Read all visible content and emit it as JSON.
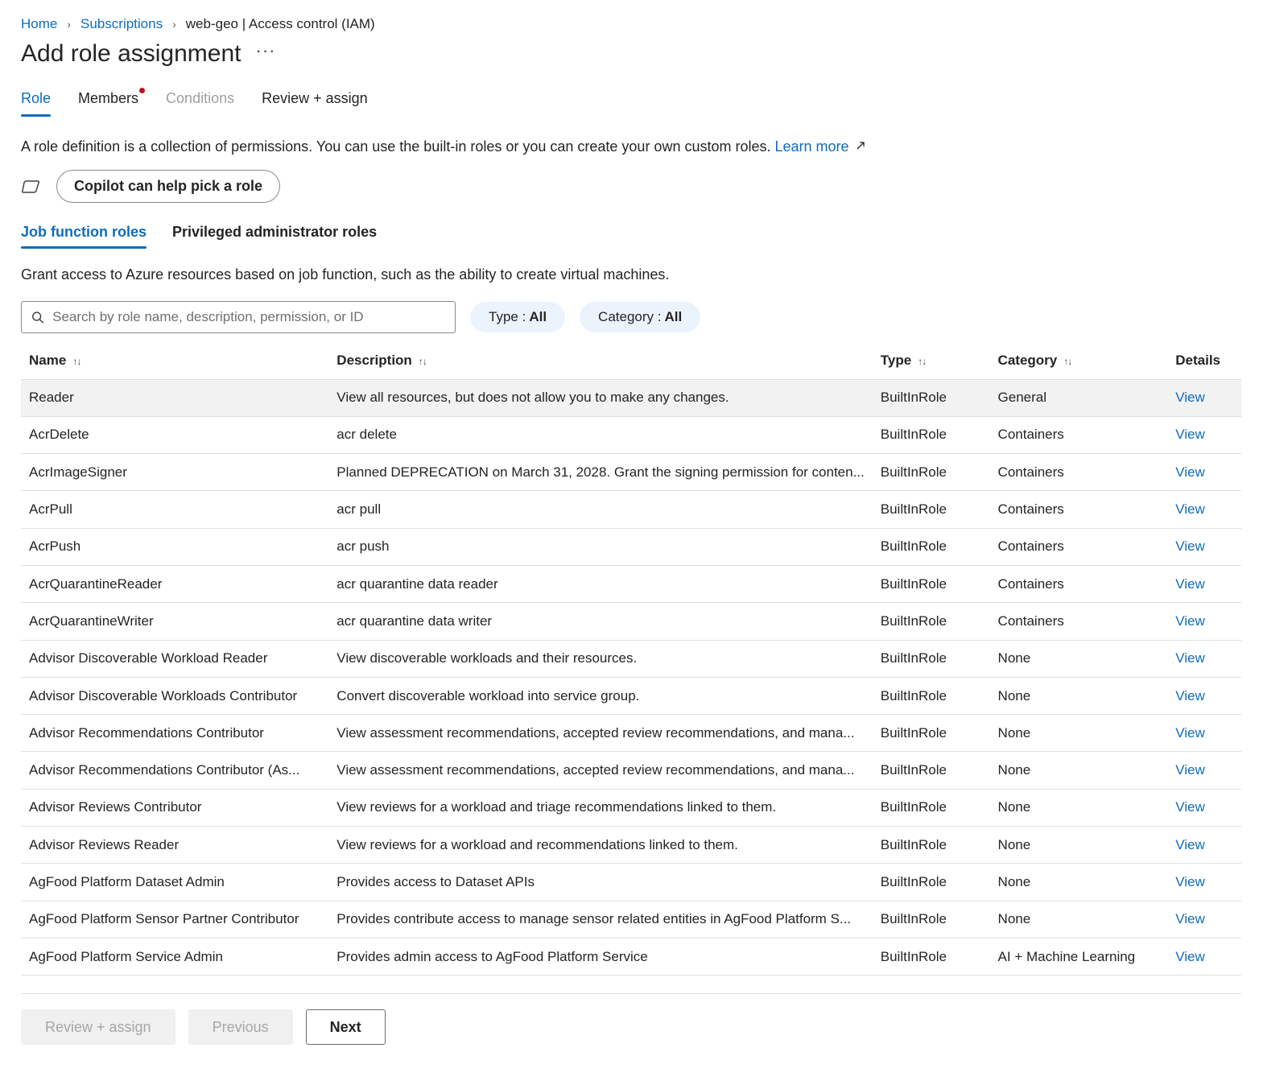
{
  "breadcrumb": {
    "items": [
      "Home",
      "Subscriptions"
    ],
    "current": "web-geo | Access control (IAM)",
    "separator": "›"
  },
  "page": {
    "title": "Add role assignment",
    "more": "···"
  },
  "wizard_tabs": [
    "Role",
    "Members",
    "Conditions",
    "Review + assign"
  ],
  "intro": {
    "text": "A role definition is a collection of permissions. You can use the built-in roles or you can create your own custom roles.",
    "link": "Learn more"
  },
  "copilot": {
    "button": "Copilot can help pick a role"
  },
  "role_tabs": [
    "Job function roles",
    "Privileged administrator roles"
  ],
  "tab_description": "Grant access to Azure resources based on job function, such as the ability to create virtual machines.",
  "search": {
    "placeholder": "Search by role name, description, permission, or ID"
  },
  "filters": {
    "type_label": "Type : ",
    "type_value": "All",
    "category_label": "Category : ",
    "category_value": "All"
  },
  "table": {
    "headers": [
      "Name",
      "Description",
      "Type",
      "Category",
      "Details"
    ],
    "rows": [
      [
        "Reader",
        "View all resources, but does not allow you to make any changes.",
        "BuiltInRole",
        "General",
        "View"
      ],
      [
        "AcrDelete",
        "acr delete",
        "BuiltInRole",
        "Containers",
        "View"
      ],
      [
        "AcrImageSigner",
        "Planned DEPRECATION on March 31, 2028. Grant the signing permission for conten...",
        "BuiltInRole",
        "Containers",
        "View"
      ],
      [
        "AcrPull",
        "acr pull",
        "BuiltInRole",
        "Containers",
        "View"
      ],
      [
        "AcrPush",
        "acr push",
        "BuiltInRole",
        "Containers",
        "View"
      ],
      [
        "AcrQuarantineReader",
        "acr quarantine data reader",
        "BuiltInRole",
        "Containers",
        "View"
      ],
      [
        "AcrQuarantineWriter",
        "acr quarantine data writer",
        "BuiltInRole",
        "Containers",
        "View"
      ],
      [
        "Advisor Discoverable Workload Reader",
        "View discoverable workloads and their resources.",
        "BuiltInRole",
        "None",
        "View"
      ],
      [
        "Advisor Discoverable Workloads Contributor",
        "Convert discoverable workload into service group.",
        "BuiltInRole",
        "None",
        "View"
      ],
      [
        "Advisor Recommendations Contributor",
        "View assessment recommendations, accepted review recommendations, and mana...",
        "BuiltInRole",
        "None",
        "View"
      ],
      [
        "Advisor Recommendations Contributor (As...",
        "View assessment recommendations, accepted review recommendations, and mana...",
        "BuiltInRole",
        "None",
        "View"
      ],
      [
        "Advisor Reviews Contributor",
        "View reviews for a workload and triage recommendations linked to them.",
        "BuiltInRole",
        "None",
        "View"
      ],
      [
        "Advisor Reviews Reader",
        "View reviews for a workload and recommendations linked to them.",
        "BuiltInRole",
        "None",
        "View"
      ],
      [
        "AgFood Platform Dataset Admin",
        "Provides access to Dataset APIs",
        "BuiltInRole",
        "None",
        "View"
      ],
      [
        "AgFood Platform Sensor Partner Contributor",
        "Provides contribute access to manage sensor related entities in AgFood Platform S...",
        "BuiltInRole",
        "None",
        "View"
      ],
      [
        "AgFood Platform Service Admin",
        "Provides admin access to AgFood Platform Service",
        "BuiltInRole",
        "AI + Machine Learning",
        "View"
      ]
    ]
  },
  "footer": {
    "review_assign": "Review + assign",
    "previous": "Previous",
    "next": "Next"
  },
  "colors": {
    "accent": "#0f6cbd",
    "notification_dot": "#c50f1f",
    "pill_bg": "#ebf3fc",
    "selected_row": "#f2f2f2"
  },
  "icons": {
    "search": "search-icon",
    "copilot": "copilot-icon",
    "sort": "sort-icon",
    "external_link": "external-link-icon"
  }
}
